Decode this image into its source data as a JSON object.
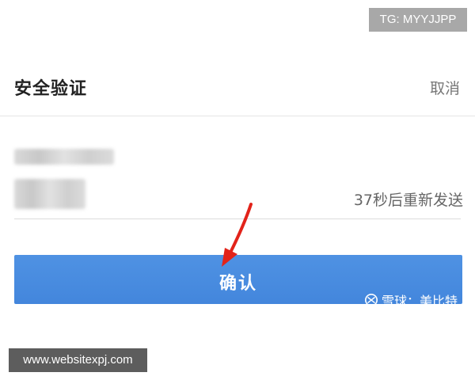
{
  "watermarks": {
    "tg": "TG: MYYJJPP",
    "website": "www.websitexpj.com",
    "xueqiu": "雪球：美比特"
  },
  "header": {
    "title": "安全验证",
    "cancel_label": "取消"
  },
  "form": {
    "countdown": "37秒后重新发送",
    "confirm_label": "确认"
  },
  "colors": {
    "button_blue": "#4a8ee0",
    "arrow_red": "#e2231a"
  },
  "icons": {
    "annotation": "red-arrow-icon",
    "xueqiu": "xueqiu-logo-icon"
  }
}
